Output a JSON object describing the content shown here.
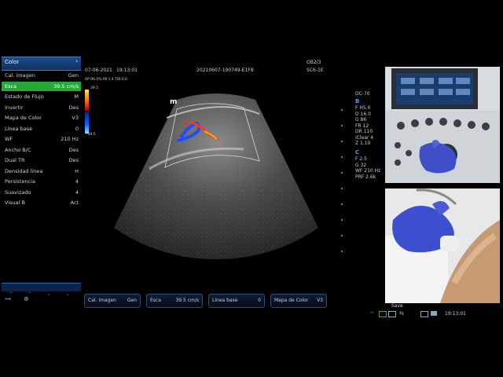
{
  "header": {
    "date": "07-06-2021",
    "time": "19:13:01",
    "study_id": "20210607-190749-E1F8",
    "preset": "OB2/3",
    "probe": "SC6-1E",
    "ap_mi_tib": "AP 96.0%  MI 1.4 TIB 0.6",
    "marker": "m"
  },
  "menu": {
    "title": "Color",
    "items": [
      {
        "label": "Cal. imagen",
        "value": "Gen"
      },
      {
        "label": "Esca",
        "value": "39.5 cm/s"
      },
      {
        "label": "Estado de Flujo",
        "value": "M"
      },
      {
        "label": "Invertir",
        "value": "Des"
      },
      {
        "label": "Mapa de Color",
        "value": "V3"
      },
      {
        "label": "Línea base",
        "value": "0"
      },
      {
        "label": "WF",
        "value": "210 Hz"
      },
      {
        "label": "Ancho B/C",
        "value": "Des"
      },
      {
        "label": "Dual TR",
        "value": "Des"
      },
      {
        "label": "Densidad línea",
        "value": "H"
      },
      {
        "label": "Persistencia",
        "value": "4"
      },
      {
        "label": "Suavizado",
        "value": "4"
      },
      {
        "label": "Visual B",
        "value": "Act"
      }
    ]
  },
  "color_scale": {
    "top": "39.5",
    "bottom": "-39.5"
  },
  "params": {
    "mode": "DC-70",
    "b_label": "B",
    "b_lines": [
      "F H5.0",
      "D 16.0",
      "G 86",
      "FR 12",
      "DR 110",
      "iClear 4",
      "Z 1.10"
    ],
    "c_label": "C",
    "c_lines": [
      "F 2.5",
      "G 32",
      "WF 210 Hz",
      "PRF 2.6k"
    ]
  },
  "bottom_buttons": [
    {
      "label": "Cal. imagen",
      "value": "Gen"
    },
    {
      "label": "Esca",
      "value": "39.5 cm/s"
    },
    {
      "label": "Línea base",
      "value": "0"
    },
    {
      "label": "Mapa de Color",
      "value": "V3"
    }
  ],
  "status": {
    "save_label": "Save",
    "time": "19:13:01"
  },
  "colors": {
    "menu_blue": "#1d4c8a",
    "selected_green": "#27a83a",
    "param_blue": "#4da3ff"
  }
}
